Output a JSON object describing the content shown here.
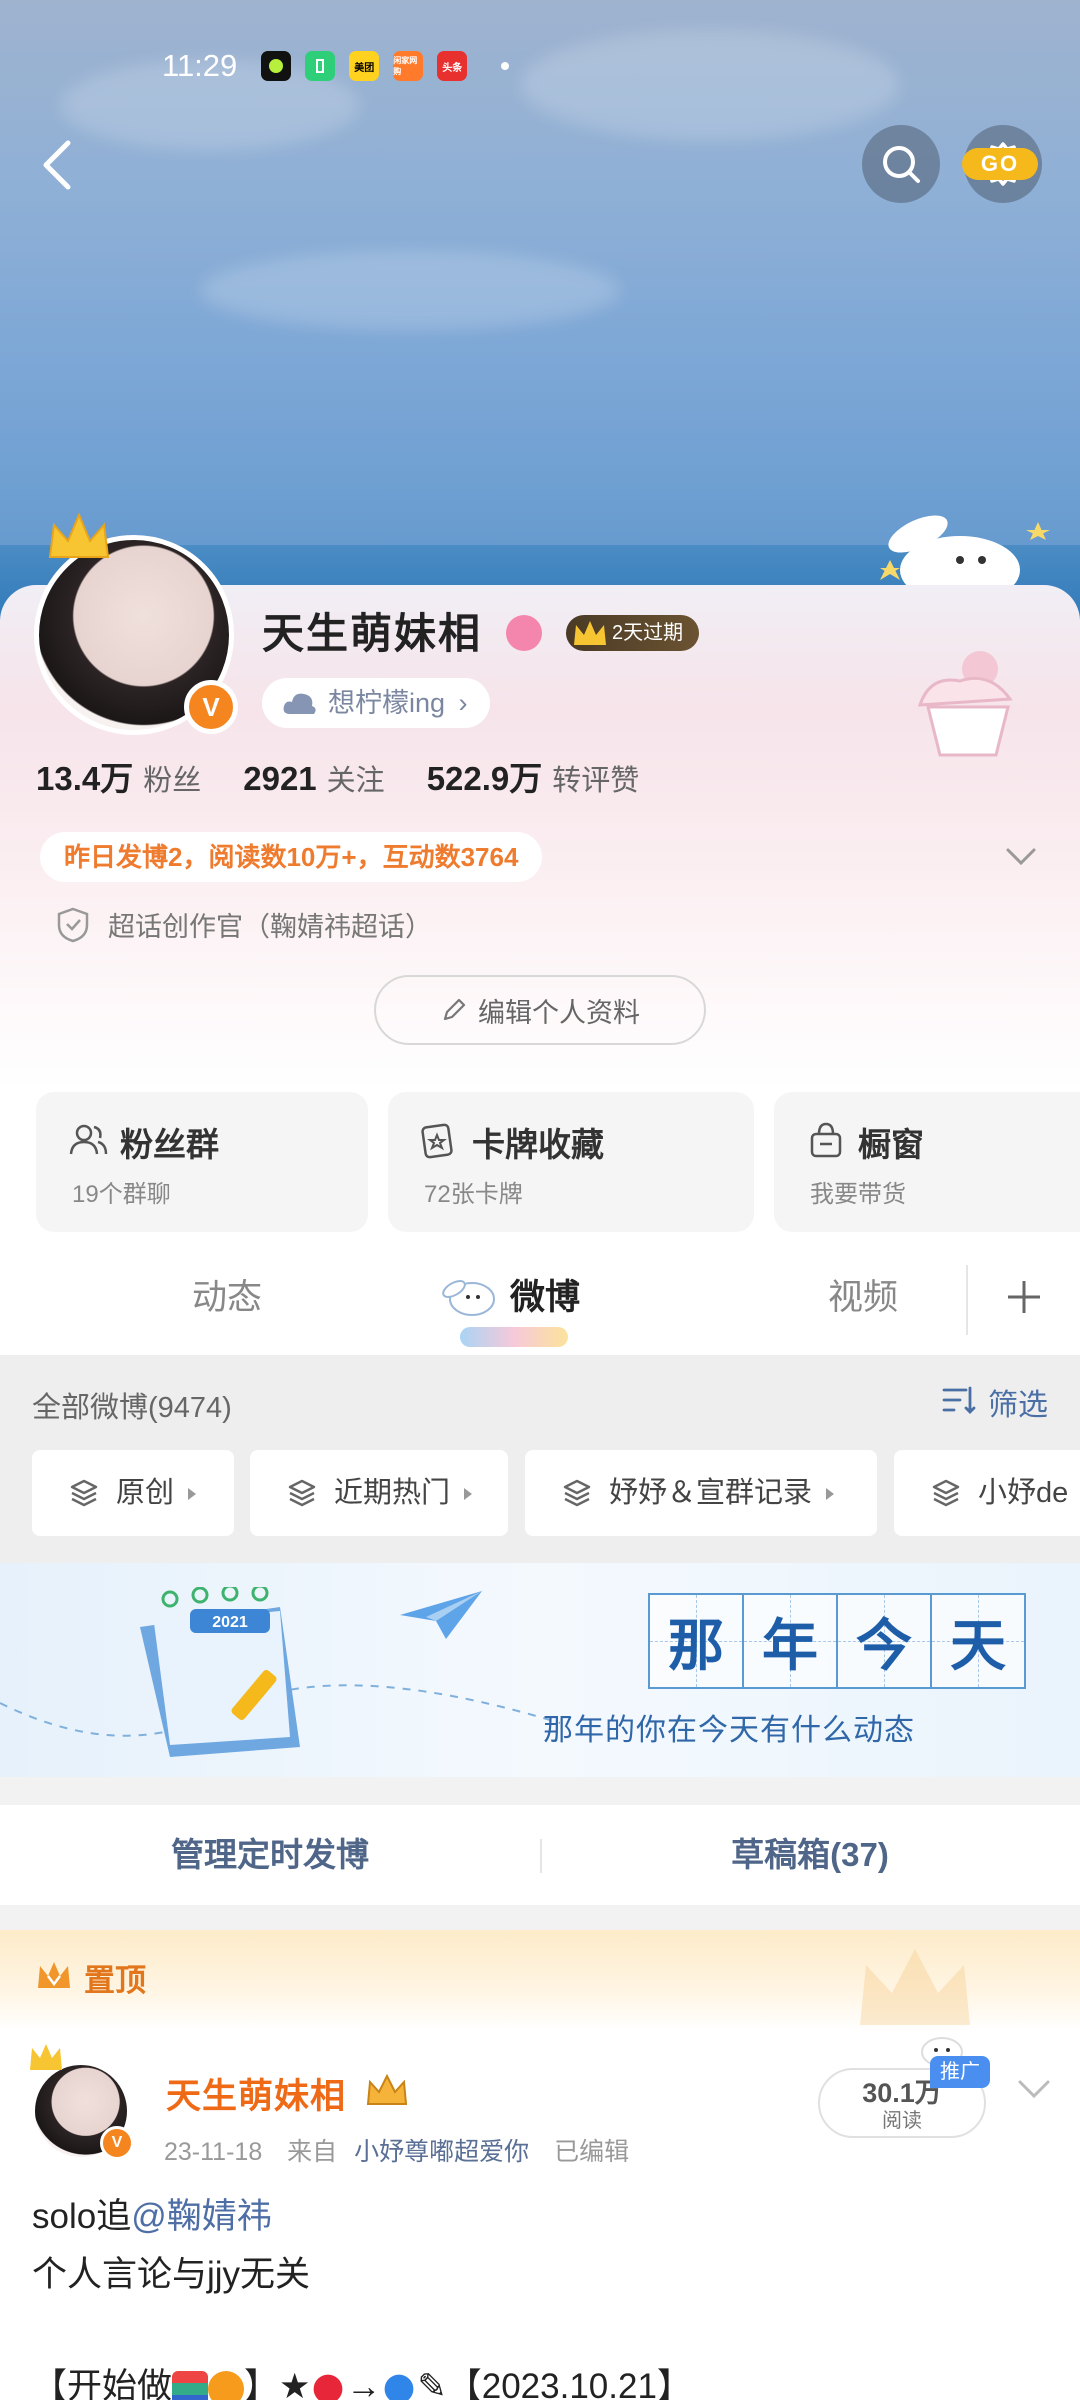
{
  "status_bar": {
    "time": "11:29",
    "apps": [
      {
        "name": "ring-app-icon",
        "color": "#111111"
      },
      {
        "name": "battery-app-icon",
        "color": "#2fcf7a"
      },
      {
        "name": "meituan-app-icon",
        "label": "美团",
        "color": "#ffd21f"
      },
      {
        "name": "taobao-app-icon",
        "label": "闲家网购",
        "color": "#ff7a2a"
      },
      {
        "name": "toutiao-app-icon",
        "label": "头条",
        "color": "#e8302f"
      }
    ]
  },
  "header": {
    "back_icon": "chevron-left-icon",
    "search_icon": "search-icon",
    "settings_icon": "gear-icon"
  },
  "profile": {
    "username": "天生萌妹相",
    "vip_badge": "2天过期",
    "verified_badge": "V",
    "mood": "想柠檬ing",
    "stats": [
      {
        "value": "13.4万",
        "label": "粉丝"
      },
      {
        "value": "2921",
        "label": "关注"
      },
      {
        "value": "522.9万",
        "label": "转评赞"
      }
    ],
    "yesterday_summary": "昨日发博2，阅读数10万+，互动数3764",
    "supertopic_role": "超话创作官（鞠婧祎超话）",
    "edit_profile_label": "编辑个人资料"
  },
  "feature_cards": [
    {
      "title": "粉丝群",
      "subtitle": "19个群聊",
      "icon": "people-icon"
    },
    {
      "title": "卡牌收藏",
      "subtitle": "72张卡牌",
      "icon": "card-icon"
    },
    {
      "title": "橱窗",
      "subtitle": "我要带货",
      "icon": "shopping-bag-icon"
    }
  ],
  "tabs": [
    {
      "label": "动态",
      "active": false
    },
    {
      "label": "微博",
      "active": true
    },
    {
      "label": "视频",
      "active": false
    }
  ],
  "feed_filter": {
    "all_count": "全部微博(9474)",
    "filter_label": "筛选",
    "chips": [
      {
        "label": "原创"
      },
      {
        "label": "近期热门"
      },
      {
        "label": "妤妤＆宣群记录"
      },
      {
        "label": "小妤de"
      }
    ]
  },
  "memory_banner": {
    "title_chars": [
      "那",
      "年",
      "今",
      "天"
    ],
    "subtitle": "那年的你在今天有什么动态",
    "go_label": "GO",
    "calendar_year": "2021"
  },
  "manage": {
    "scheduled_label": "管理定时发博",
    "drafts_label": "草稿箱(37)"
  },
  "pinned_post": {
    "pinned_label": "置顶",
    "author": "天生萌妹相",
    "date": "23-11-18",
    "source_prefix": "来自",
    "source": "小妤尊嘟超爱你",
    "edited": "已编辑",
    "read_count": "30.1万",
    "read_label": "阅读",
    "promo_label": "推广",
    "line1_prefix": "solo追",
    "line1_mention": "@鞠婧祎",
    "line2": "个人言论与jjy无关",
    "line3_start": "【开始做",
    "line3_mid": "】★",
    "line3_end": "【2023.10.21】"
  }
}
